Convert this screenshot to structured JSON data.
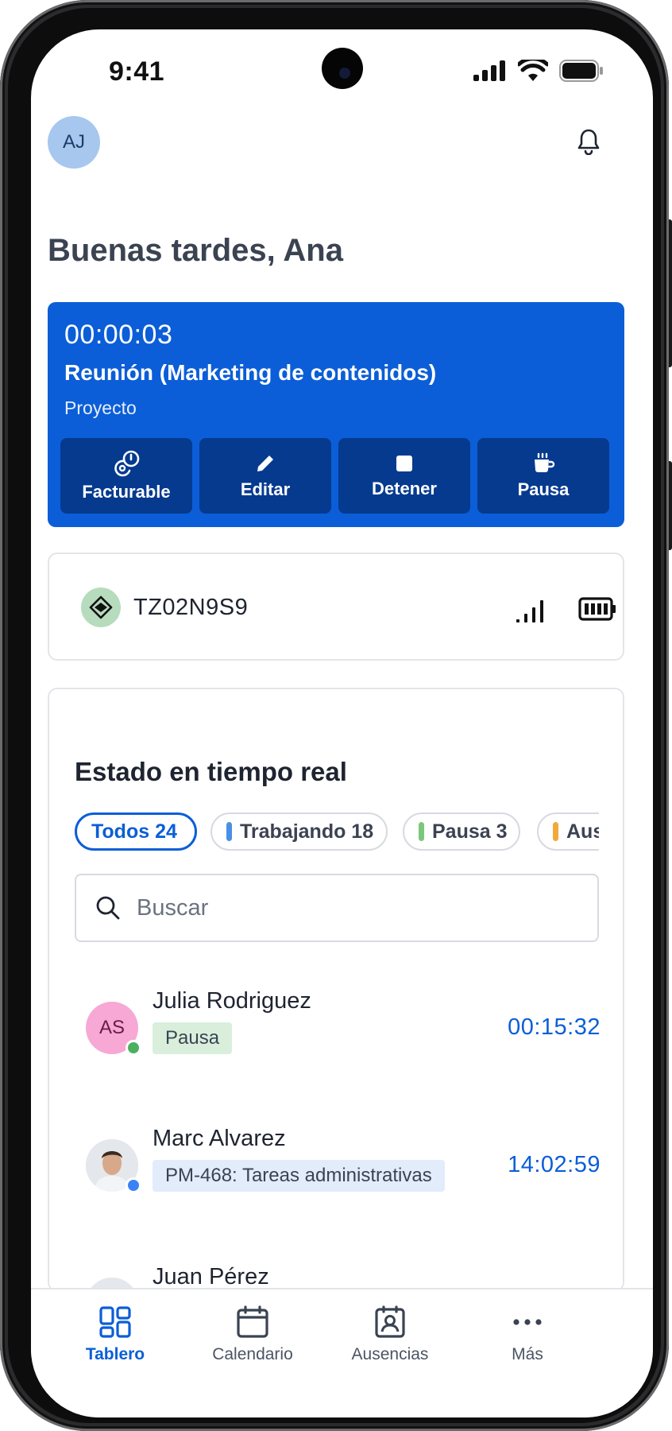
{
  "status_bar": {
    "time": "9:41"
  },
  "header": {
    "avatar_initials": "AJ",
    "greeting": "Buenas tardes, Ana"
  },
  "timer": {
    "elapsed": "00:00:03",
    "title": "Reunión (Marketing de contenidos)",
    "subtitle": "Proyecto",
    "actions": [
      {
        "label": "Facturable",
        "icon": "billable-clock-icon"
      },
      {
        "label": "Editar",
        "icon": "pencil-icon"
      },
      {
        "label": "Detener",
        "icon": "stop-icon"
      },
      {
        "label": "Pausa",
        "icon": "coffee-icon"
      }
    ]
  },
  "device": {
    "id": "TZ02N9S9",
    "icon": "device-diamond-icon"
  },
  "realtime": {
    "title": "Estado en tiempo real",
    "filters": [
      {
        "label": "Todos 24",
        "active": true
      },
      {
        "label": "Trabajando 18",
        "color": "#4a90e2"
      },
      {
        "label": "Pausa 3",
        "color": "#7cc87a"
      },
      {
        "label": "Ausente",
        "color": "#f2a93b"
      }
    ],
    "search_placeholder": "Buscar",
    "people": [
      {
        "initials": "AS",
        "name": "Julia Rodriguez",
        "status": "Pausa",
        "time": "00:15:32",
        "dot_color": "#4caf60"
      },
      {
        "name": "Marc Alvarez",
        "status": "PM-468: Tareas administrativas",
        "time": "14:02:59",
        "dot_color": "#3b82f6"
      },
      {
        "name": "Juan Pérez"
      }
    ]
  },
  "nav": {
    "items": [
      {
        "label": "Tablero",
        "active": true
      },
      {
        "label": "Calendario"
      },
      {
        "label": "Ausencias"
      },
      {
        "label": "Más"
      }
    ]
  }
}
